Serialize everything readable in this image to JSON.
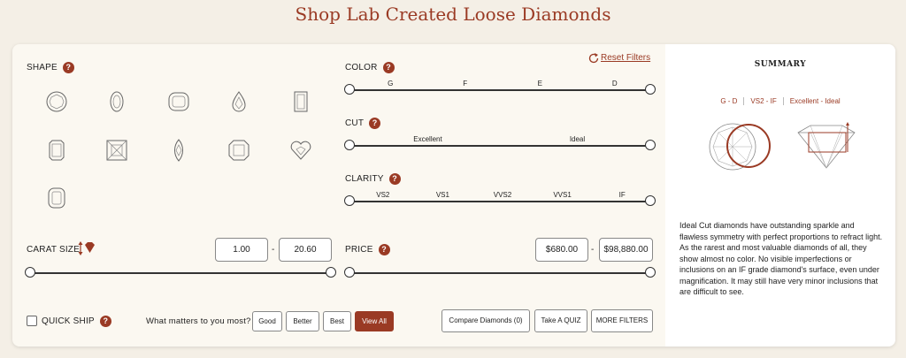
{
  "page": {
    "title": "Shop Lab Created Loose Diamonds"
  },
  "shape": {
    "label": "SHAPE",
    "help": "?",
    "items": [
      "round-icon",
      "oval-icon",
      "cushion-icon",
      "pear-icon",
      "emerald-icon",
      "radiant-icon",
      "princess-icon",
      "marquise-icon",
      "asscher-icon",
      "heart-icon",
      "elongated-cushion-icon"
    ]
  },
  "color": {
    "label": "COLOR",
    "help": "?",
    "grades": [
      "G",
      "F",
      "E",
      "D"
    ]
  },
  "cut": {
    "label": "CUT",
    "help": "?",
    "grades": [
      "Excellent",
      "Ideal"
    ]
  },
  "clarity": {
    "label": "CLARITY",
    "help": "?",
    "grades": [
      "VS2",
      "VS1",
      "VVS2",
      "VVS1",
      "IF"
    ]
  },
  "carat": {
    "label": "CARAT SIZE",
    "icon": "diamond-arrows-icon",
    "min": "1.00",
    "max": "20.60",
    "separator": "-"
  },
  "price": {
    "label": "PRICE",
    "help": "?",
    "min": "$680.00",
    "max": "$98,880.00",
    "separator": "-"
  },
  "filters": {
    "reset": "Reset Filters"
  },
  "footer": {
    "quick_ship": "QUICK SHIP",
    "help": "?",
    "matters_label": "What matters to you most?",
    "options": [
      "Good",
      "Better",
      "Best",
      "View All"
    ],
    "compare": "Compare Diamonds (0)",
    "quiz": "Take A QUIZ",
    "more": "MORE FILTERS"
  },
  "summary": {
    "title": "SUMMARY",
    "tags": [
      "G - D",
      "VS2 - IF",
      "Excellent - Ideal"
    ],
    "text": "Ideal Cut diamonds have outstanding sparkle and flawless symmetry with perfect proportions to refract light. As the rarest and most valuable diamonds of all, they show almost no color. No visible imperfections or inclusions on an IF grade diamond's surface, even under magnification. It may still have very minor inclusions that are difficult to see."
  },
  "colors": {
    "accent": "#9a3a24",
    "background": "#f4efe6",
    "panel": "#fbf8f1"
  }
}
